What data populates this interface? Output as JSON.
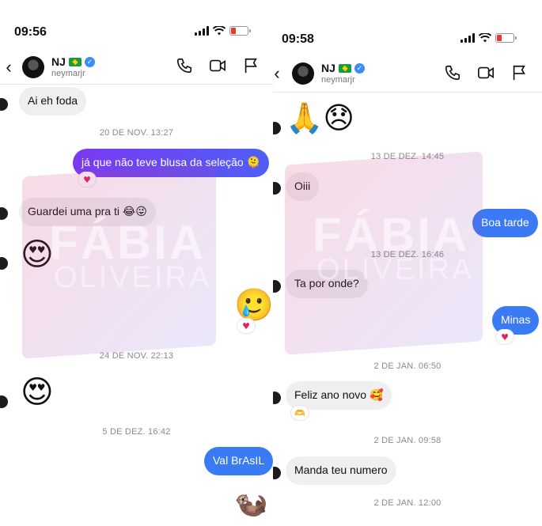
{
  "left": {
    "status_time": "09:56",
    "contact": {
      "name": "NJ",
      "username": "neymarjr"
    },
    "messages": {
      "m1": "Ai eh foda",
      "ts1": "20 DE NOV. 13:27",
      "m2": "já que não teve blusa da seleção 🫠",
      "m3": "Guardei uma pra ti 😂😜",
      "e1": "😍",
      "e2": "🥲",
      "ts2": "24 DE NOV. 22:13",
      "e3": "😍",
      "ts3": "5 DE DEZ. 16:42",
      "m4": "Val BrAsIL",
      "e4": "🦦"
    },
    "reaction": "♥"
  },
  "right": {
    "status_time": "09:58",
    "contact": {
      "name": "NJ",
      "username": "neymarjr"
    },
    "messages": {
      "e1": "🙏😞",
      "ts1": "13 DE DEZ. 14:45",
      "m1": "Oiii",
      "m2": "Boa tarde",
      "ts2": "13 DE DEZ. 16:46",
      "m3": "Ta por onde?",
      "m4": "Minas",
      "ts3": "2 DE JAN. 06:50",
      "m5": "Feliz ano novo 🥰",
      "r_m5": "🫶",
      "ts4": "2 DE JAN. 09:58",
      "m6": "Manda teu numero",
      "ts5": "2 DE JAN. 12:00"
    },
    "reaction": "♥"
  },
  "watermark": {
    "line1": "FÁBIA",
    "line2": "OLIVEIRA"
  },
  "colors": {
    "outgoing_gradient": [
      "#7b3af0",
      "#4f5ff5"
    ],
    "outgoing_blue": "#3a7bf5",
    "incoming": "#efefef",
    "battery_low": "#e53935"
  },
  "icons": [
    "back-chevron-icon",
    "phone-icon",
    "video-icon",
    "flag-icon",
    "verified-icon",
    "brazil-flag-icon",
    "signal-icon",
    "wifi-icon",
    "battery-icon",
    "heart-icon"
  ]
}
